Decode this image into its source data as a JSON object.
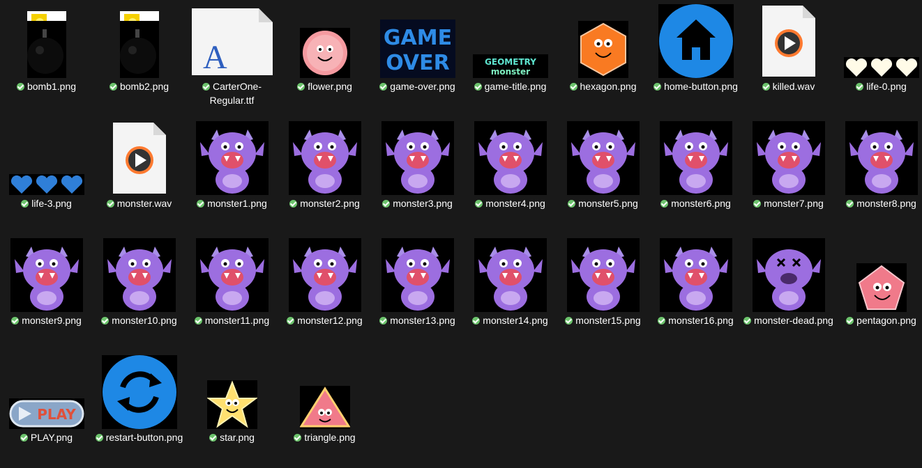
{
  "files": [
    {
      "name": "bomb1.png",
      "icon": "bomb"
    },
    {
      "name": "bomb2.png",
      "icon": "bomb"
    },
    {
      "name": "CarterOne-Regular.ttf",
      "icon": "font-file",
      "glyph": "A"
    },
    {
      "name": "flower.png",
      "icon": "flower-face"
    },
    {
      "name": "game-over.png",
      "icon": "game-over-text",
      "text1": "GAME",
      "text2": "OVER"
    },
    {
      "name": "game-title.png",
      "icon": "game-title-logo",
      "text1": "GEOMETRY",
      "text2": "monster"
    },
    {
      "name": "hexagon.png",
      "icon": "hexagon-face"
    },
    {
      "name": "home-button.png",
      "icon": "home-icon"
    },
    {
      "name": "killed.wav",
      "icon": "audio-file"
    },
    {
      "name": "life-0.png",
      "icon": "hearts-white"
    },
    {
      "name": "life-3.png",
      "icon": "hearts-blue"
    },
    {
      "name": "monster.wav",
      "icon": "audio-file"
    },
    {
      "name": "monster1.png",
      "icon": "monster"
    },
    {
      "name": "monster2.png",
      "icon": "monster"
    },
    {
      "name": "monster3.png",
      "icon": "monster"
    },
    {
      "name": "monster4.png",
      "icon": "monster"
    },
    {
      "name": "monster5.png",
      "icon": "monster"
    },
    {
      "name": "monster6.png",
      "icon": "monster"
    },
    {
      "name": "monster7.png",
      "icon": "monster"
    },
    {
      "name": "monster8.png",
      "icon": "monster"
    },
    {
      "name": "monster9.png",
      "icon": "monster"
    },
    {
      "name": "monster10.png",
      "icon": "monster"
    },
    {
      "name": "monster11.png",
      "icon": "monster"
    },
    {
      "name": "monster12.png",
      "icon": "monster"
    },
    {
      "name": "monster13.png",
      "icon": "monster"
    },
    {
      "name": "monster14.png",
      "icon": "monster"
    },
    {
      "name": "monster15.png",
      "icon": "monster"
    },
    {
      "name": "monster16.png",
      "icon": "monster"
    },
    {
      "name": "monster-dead.png",
      "icon": "monster-dead"
    },
    {
      "name": "pentagon.png",
      "icon": "pentagon-face"
    },
    {
      "name": "PLAY.png",
      "icon": "play-button",
      "text1": "PLAY"
    },
    {
      "name": "restart-button.png",
      "icon": "restart-icon"
    },
    {
      "name": "star.png",
      "icon": "star-face"
    },
    {
      "name": "triangle.png",
      "icon": "triangle-face"
    }
  ],
  "colors": {
    "background": "#191919",
    "sync_check": "#6cc36c",
    "monster_purple": "#9c6ee0",
    "button_blue": "#1e88e5"
  }
}
